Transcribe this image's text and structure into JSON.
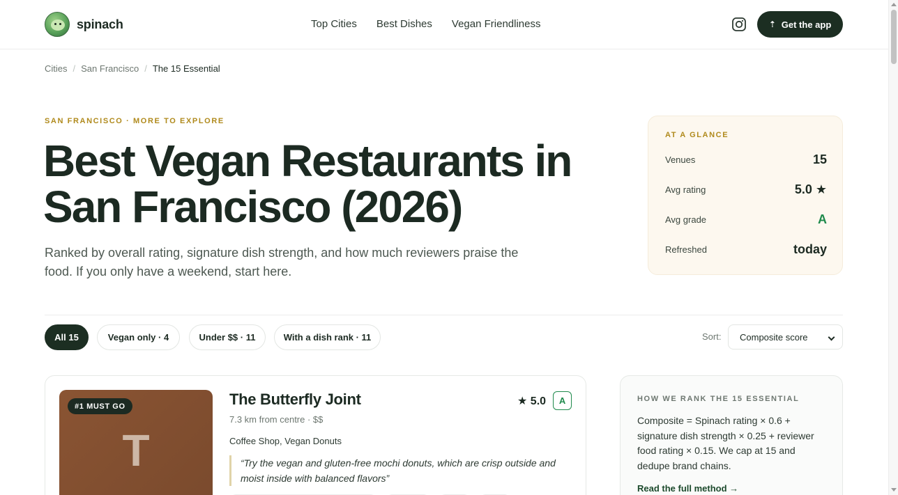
{
  "header": {
    "brand": "spinach",
    "nav": [
      "Top Cities",
      "Best Dishes",
      "Vegan Friendliness"
    ],
    "app_button": "Get the app"
  },
  "breadcrumb": {
    "items": [
      "Cities",
      "San Francisco"
    ],
    "current": "The 15 Essential"
  },
  "hero": {
    "eyebrow": "SAN FRANCISCO · MORE TO EXPLORE",
    "title": "Best Vegan Restaurants in San Francisco (2026)",
    "subtitle": "Ranked by overall rating, signature dish strength, and how much reviewers praise the food. If you only have a weekend, start here."
  },
  "glance": {
    "title": "AT A GLANCE",
    "rows": [
      {
        "label": "Venues",
        "value": "15"
      },
      {
        "label": "Avg rating",
        "value": "5.0 ★"
      },
      {
        "label": "Avg grade",
        "value": "A"
      },
      {
        "label": "Refreshed",
        "value": "today"
      }
    ]
  },
  "filters": {
    "chips": [
      "All 15",
      "Vegan only · 4",
      "Under $$ · 11",
      "With a dish rank · 11"
    ],
    "sort_label": "Sort:",
    "sort_value": "Composite score"
  },
  "listing": {
    "badge": "#1 MUST GO",
    "initial": "T",
    "name": "The Butterfly Joint",
    "meta": "7.3 km from centre · $$",
    "categories": "Coffee Shop, Vegan Donuts",
    "quote": "“Try the vegan and gluten-free mochi donuts, which are crisp outside and moist inside with balanced flavors”",
    "rating": "★ 5.0",
    "grade": "A"
  },
  "method": {
    "title": "HOW WE RANK THE 15 ESSENTIAL",
    "body": "Composite = Spinach rating × 0.6 + signature dish strength × 0.25 + reviewer food rating × 0.15. We cap at 15 and dedupe brand chains.",
    "link": "Read the full method →"
  },
  "colors": {
    "brand_dark": "#1c2e22",
    "accent_gold": "#b08a1c",
    "grade_green": "#1f8a4c",
    "glance_bg": "#fdf8ef"
  }
}
